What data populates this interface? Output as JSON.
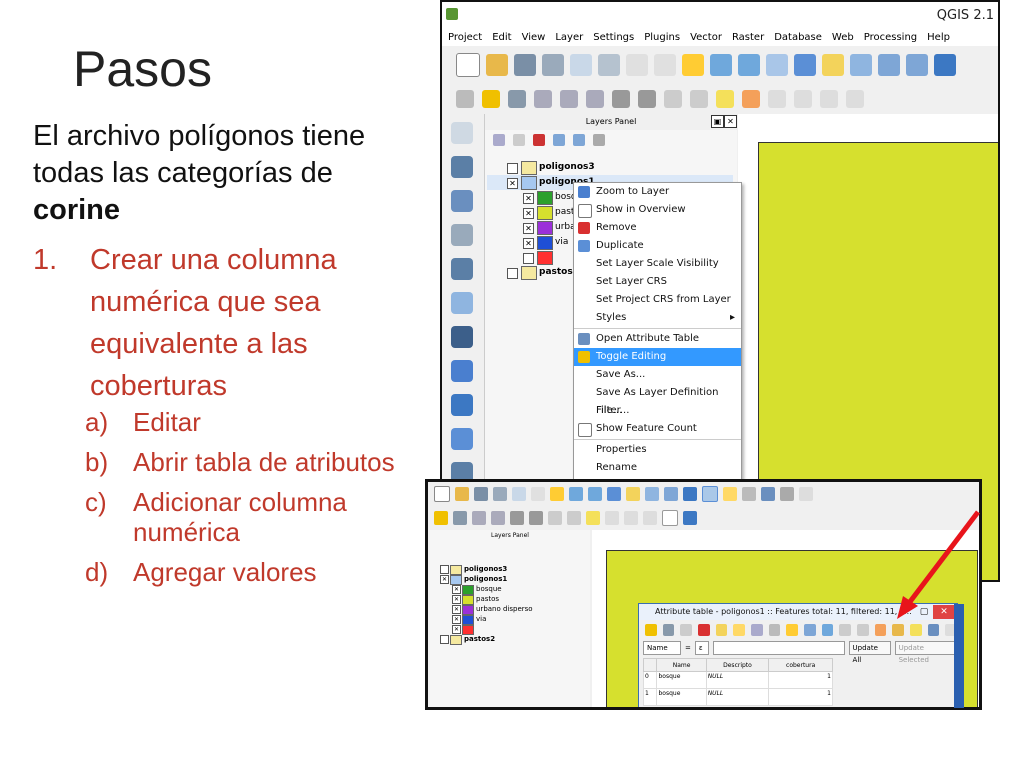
{
  "slide": {
    "title": "Pasos",
    "lead_prefix": "El archivo polígonos tiene todas las categorías de ",
    "lead_bold": "corine",
    "step1_num": "1.",
    "step1_text": "Crear una columna numérica que sea equivalente a las coberturas",
    "substeps": [
      {
        "letter": "a)",
        "text": "Editar"
      },
      {
        "letter": "b)",
        "text": "Abrir tabla de atributos"
      },
      {
        "letter": "c)",
        "text": "Adicionar columna numérica"
      },
      {
        "letter": "d)",
        "text": "Agregar valores"
      }
    ]
  },
  "qgis": {
    "window_title": "QGIS 2.1",
    "menu": [
      "Project",
      "Edit",
      "View",
      "Layer",
      "Settings",
      "Plugins",
      "Vector",
      "Raster",
      "Database",
      "Web",
      "Processing",
      "Help"
    ],
    "layers_panel_title": "Layers Panel",
    "layers": [
      {
        "name": "poligonos3",
        "checked": false,
        "color": "#f5e9a0"
      },
      {
        "name": "poligonos1",
        "checked": true,
        "color": "#a6c8f0"
      },
      {
        "name": "bosq",
        "checked": true,
        "color": "#2ca02c",
        "child": true
      },
      {
        "name": "past",
        "checked": true,
        "color": "#d6e02e",
        "child": true
      },
      {
        "name": "urba",
        "checked": true,
        "color": "#9b30d9",
        "child": true
      },
      {
        "name": "via",
        "checked": true,
        "color": "#1f4fd6",
        "child": true
      },
      {
        "name": "",
        "checked": false,
        "color": "#ff3030",
        "child": true
      },
      {
        "name": "pastos2",
        "checked": false,
        "color": "#f5e9a0"
      }
    ],
    "context_menu": [
      {
        "label": "Zoom to Layer",
        "icon_color": "#4a7fcf"
      },
      {
        "label": "Show in Overview",
        "icon_color": "#ffffff"
      },
      {
        "label": "Remove",
        "icon_color": "#d93030"
      },
      {
        "label": "Duplicate",
        "icon_color": "#5b8fd6"
      },
      {
        "label": "Set Layer Scale Visibility"
      },
      {
        "label": "Set Layer CRS"
      },
      {
        "label": "Set Project CRS from Layer"
      },
      {
        "label": "Styles",
        "arrow": "▸"
      },
      {
        "label": "Open Attribute Table",
        "icon_color": "#6a8fbf",
        "sep_before": true
      },
      {
        "label": "Toggle Editing",
        "icon_color": "#f0c000",
        "active": true
      },
      {
        "label": "Save As..."
      },
      {
        "label": "Save As Layer Definition File..."
      },
      {
        "label": "Filter..."
      },
      {
        "label": "Show Feature Count",
        "icon_color": "#ffffff"
      },
      {
        "label": "Properties",
        "sep_before": true
      },
      {
        "label": "Rename"
      }
    ]
  },
  "inset": {
    "layers_panel_title": "Layers Panel",
    "layers": [
      {
        "name": "poligonos3",
        "checked": false,
        "color": "#f5e9a0"
      },
      {
        "name": "poligonos1",
        "checked": true,
        "color": "#a6c8f0"
      },
      {
        "name": "bosque",
        "checked": true,
        "color": "#2ca02c",
        "child": true
      },
      {
        "name": "pastos",
        "checked": true,
        "color": "#d6e02e",
        "child": true
      },
      {
        "name": "urbano disperso",
        "checked": true,
        "color": "#9b30d9",
        "child": true
      },
      {
        "name": "via",
        "checked": true,
        "color": "#1f4fd6",
        "child": true
      },
      {
        "name": "",
        "checked": true,
        "color": "#ff3030",
        "child": true
      },
      {
        "name": "pastos2",
        "checked": false,
        "color": "#f5e9a0"
      }
    ],
    "attr_title": "Attribute table - poligonos1 :: Features total: 11, filtered: 11, s...",
    "filter_field": "Name",
    "update_all": "Update All",
    "update_selected": "Update Selected",
    "columns": [
      "",
      "Name",
      "Descripto",
      "cobertura"
    ],
    "rows": [
      [
        "0",
        "bosque",
        "NULL",
        "1"
      ],
      [
        "1",
        "bosque",
        "NULL",
        "1"
      ]
    ]
  }
}
